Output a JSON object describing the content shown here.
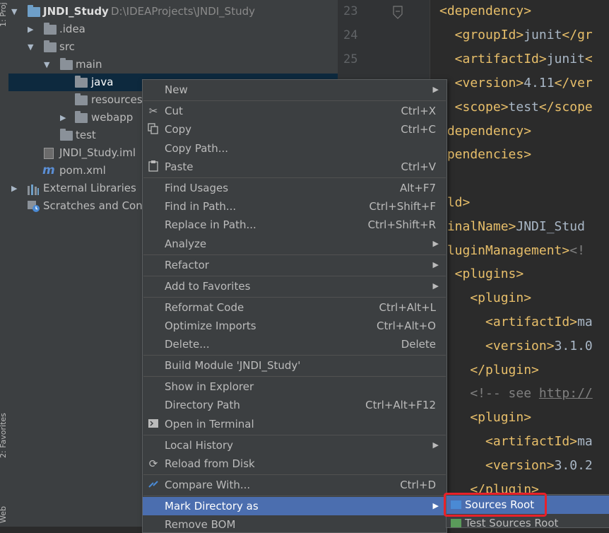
{
  "side_tabs": {
    "project": "1: Proj",
    "favorites": "2: Favorites",
    "web": "Web"
  },
  "project_tree": [
    {
      "label": "JNDI_Study",
      "path": "D:\\IDEAProjects\\JNDI_Study",
      "icon": "module-folder-icon",
      "expanded": true,
      "depth": 0
    },
    {
      "label": ".idea",
      "icon": "folder-icon",
      "expanded": false,
      "depth": 1
    },
    {
      "label": "src",
      "icon": "folder-icon",
      "expanded": true,
      "depth": 1
    },
    {
      "label": "main",
      "icon": "folder-icon",
      "expanded": true,
      "depth": 2
    },
    {
      "label": "java",
      "icon": "folder-icon",
      "selected": true,
      "depth": 3
    },
    {
      "label": "resources",
      "icon": "folder-icon",
      "depth": 3
    },
    {
      "label": "webapp",
      "icon": "web-folder-icon",
      "expanded": false,
      "depth": 3
    },
    {
      "label": "test",
      "icon": "folder-icon",
      "depth": 2
    },
    {
      "label": "JNDI_Study.iml",
      "icon": "iml-file-icon",
      "depth": 1
    },
    {
      "label": "pom.xml",
      "icon": "maven-icon",
      "depth": 1
    },
    {
      "label": "External Libraries",
      "icon": "libraries-icon",
      "expanded": false,
      "depth": 0
    },
    {
      "label": "Scratches and Cons",
      "icon": "scratches-icon",
      "depth": 0
    }
  ],
  "editor": {
    "line_numbers": [
      "23",
      "24",
      "25"
    ],
    "code_lines": [
      "<dependency>",
      "  <groupId>junit</gr",
      "  <artifactId>junit<",
      "  <version>4.11</ver",
      "  <scope>test</scope",
      "/dependency>",
      "ependencies>",
      "",
      "ild>",
      "finalName>JNDI_Stud",
      "pluginManagement><!",
      "  <plugins>",
      "    <plugin>",
      "      <artifactId>ma",
      "      <version>3.1.0",
      "    </plugin>",
      "    <!-- see http://",
      "    <plugin>",
      "      <artifactId>ma",
      "      <version>3.0.2",
      "    </plugin>"
    ]
  },
  "context_menu": {
    "items": [
      {
        "label": "New",
        "submenu": true
      },
      {
        "label": "Cut",
        "shortcut": "Ctrl+X",
        "icon": "scissors-icon"
      },
      {
        "label": "Copy",
        "shortcut": "Ctrl+C",
        "icon": "copy-icon"
      },
      {
        "label": "Copy Path...",
        "shortcut": ""
      },
      {
        "label": "Paste",
        "shortcut": "Ctrl+V",
        "icon": "paste-icon"
      },
      {
        "label": "Find Usages",
        "shortcut": "Alt+F7"
      },
      {
        "label": "Find in Path...",
        "shortcut": "Ctrl+Shift+F"
      },
      {
        "label": "Replace in Path...",
        "shortcut": "Ctrl+Shift+R"
      },
      {
        "label": "Analyze",
        "submenu": true
      },
      {
        "label": "Refactor",
        "submenu": true
      },
      {
        "label": "Add to Favorites",
        "submenu": true
      },
      {
        "label": "Reformat Code",
        "shortcut": "Ctrl+Alt+L"
      },
      {
        "label": "Optimize Imports",
        "shortcut": "Ctrl+Alt+O"
      },
      {
        "label": "Delete...",
        "shortcut": "Delete"
      },
      {
        "label": "Build Module 'JNDI_Study'",
        "shortcut": ""
      },
      {
        "label": "Show in Explorer",
        "shortcut": ""
      },
      {
        "label": "Directory Path",
        "shortcut": "Ctrl+Alt+F12"
      },
      {
        "label": "Open in Terminal",
        "icon": "terminal-icon"
      },
      {
        "label": "Local History",
        "submenu": true
      },
      {
        "label": "Reload from Disk",
        "icon": "reload-icon"
      },
      {
        "label": "Compare With...",
        "shortcut": "Ctrl+D",
        "icon": "compare-icon"
      },
      {
        "label": "Mark Directory as",
        "submenu": true,
        "active": true
      },
      {
        "label": "Remove BOM"
      }
    ]
  },
  "submenu": {
    "items": [
      {
        "label": "Sources Root",
        "active": true,
        "icon": "sources-root-icon",
        "color": "#4a8ad4"
      },
      {
        "label": "Test Sources Root",
        "icon": "test-sources-root-icon",
        "color": "#5a9a5a"
      }
    ]
  },
  "colors": {
    "selection": "#4b6eaf",
    "highlight_border": "#e8212a",
    "tag": "#e8bf6a"
  }
}
